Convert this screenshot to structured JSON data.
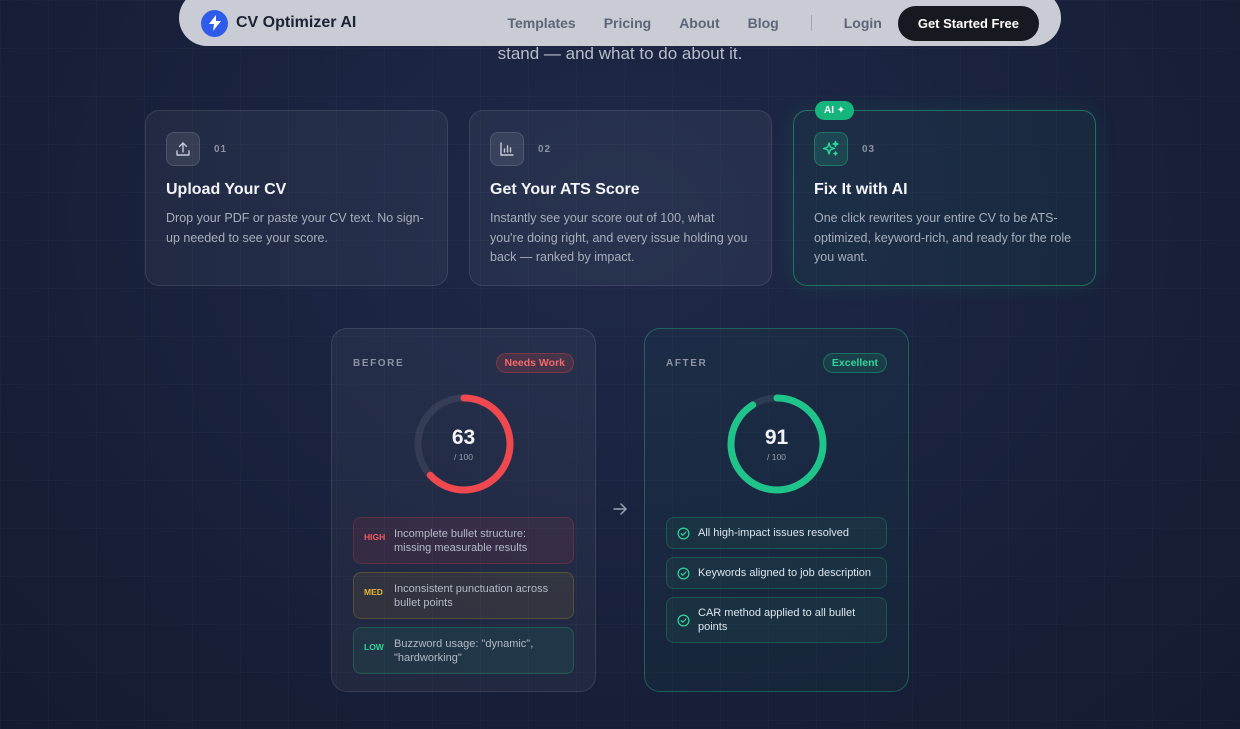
{
  "nav": {
    "brand": "CV Optimizer AI",
    "links": [
      "Templates",
      "Pricing",
      "About",
      "Blog"
    ],
    "login": "Login",
    "cta": "Get Started Free"
  },
  "hero": {
    "subtitle_tail": "stand — and what to do about it."
  },
  "steps": [
    {
      "num": "01",
      "title": "Upload Your CV",
      "desc": "Drop your PDF or paste your CV text. No sign-up needed to see your score.",
      "icon": "upload-icon"
    },
    {
      "num": "02",
      "title": "Get Your ATS Score",
      "desc": "Instantly see your score out of 100, what you're doing right, and every issue holding you back — ranked by impact.",
      "icon": "bar-chart-icon"
    },
    {
      "num": "03",
      "title": "Fix It with AI",
      "desc": "One click rewrites your entire CV to be ATS-optimized, keyword-rich, and ready for the role you want.",
      "icon": "sparkles-icon",
      "badge": "AI ✦"
    }
  ],
  "before": {
    "label": "BEFORE",
    "badge": "Needs Work",
    "score": 63,
    "score_max": "/ 100",
    "issues": [
      {
        "severity": "HIGH",
        "text": "Incomplete bullet structure: missing measurable results"
      },
      {
        "severity": "MED",
        "text": "Inconsistent punctuation across bullet points"
      },
      {
        "severity": "LOW",
        "text": "Buzzword usage: \"dynamic\", \"hardworking\""
      }
    ]
  },
  "after": {
    "label": "AFTER",
    "badge": "Excellent",
    "score": 91,
    "score_max": "/ 100",
    "checks": [
      "All high-impact issues resolved",
      "Keywords aligned to job description",
      "CAR method applied to all bullet points"
    ]
  },
  "colors": {
    "accent_blue": "#2f5bea",
    "bad": "#f0484f",
    "good": "#1fc48a"
  }
}
